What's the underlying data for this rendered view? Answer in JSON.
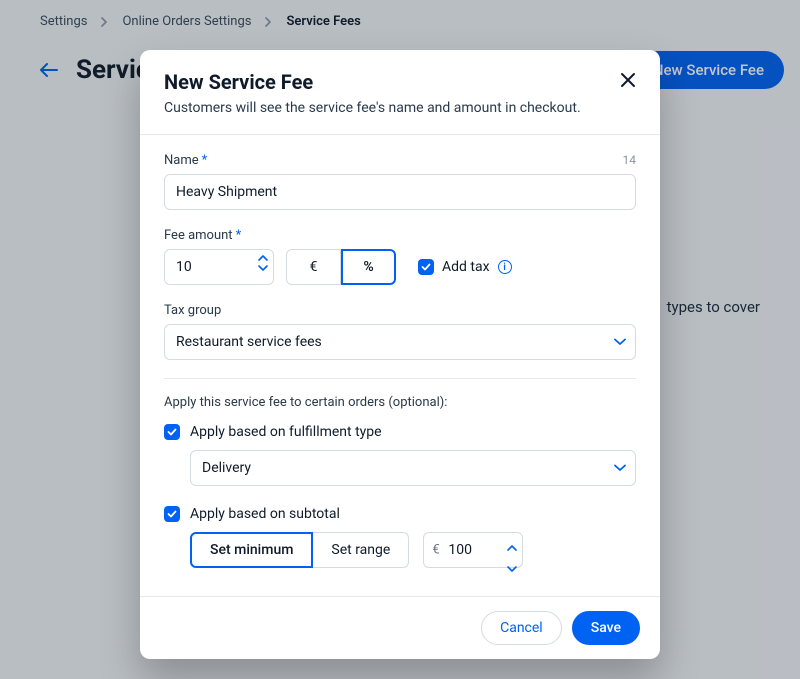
{
  "breadcrumbs": {
    "a": "Settings",
    "b": "Online Orders Settings",
    "c": "Service Fees"
  },
  "page": {
    "title": "Service Fees",
    "new_fee_btn": "New Service Fee",
    "bg_hint_fragment": "types to cover"
  },
  "modal": {
    "title": "New Service Fee",
    "subtitle": "Customers will see the service fee's name and amount in checkout.",
    "name_label": "Name",
    "name_count": "14",
    "name_value": "Heavy Shipment",
    "fee_label": "Fee amount",
    "fee_value": "10",
    "currency_symbol": "€",
    "percent_symbol": "%",
    "unit_selected": "percent",
    "add_tax_label": "Add tax",
    "add_tax_checked": true,
    "tax_group_label": "Tax group",
    "tax_group_value": "Restaurant service fees",
    "apply_section_label": "Apply this service fee to certain orders (optional):",
    "fulfillment": {
      "checked": true,
      "label": "Apply based on fulfillment type",
      "value": "Delivery"
    },
    "subtotal": {
      "checked": true,
      "label": "Apply based on subtotal",
      "set_min": "Set minimum",
      "set_range": "Set range",
      "mode_selected": "min",
      "currency": "€",
      "min_value": "100"
    },
    "footer": {
      "cancel": "Cancel",
      "save": "Save"
    }
  }
}
